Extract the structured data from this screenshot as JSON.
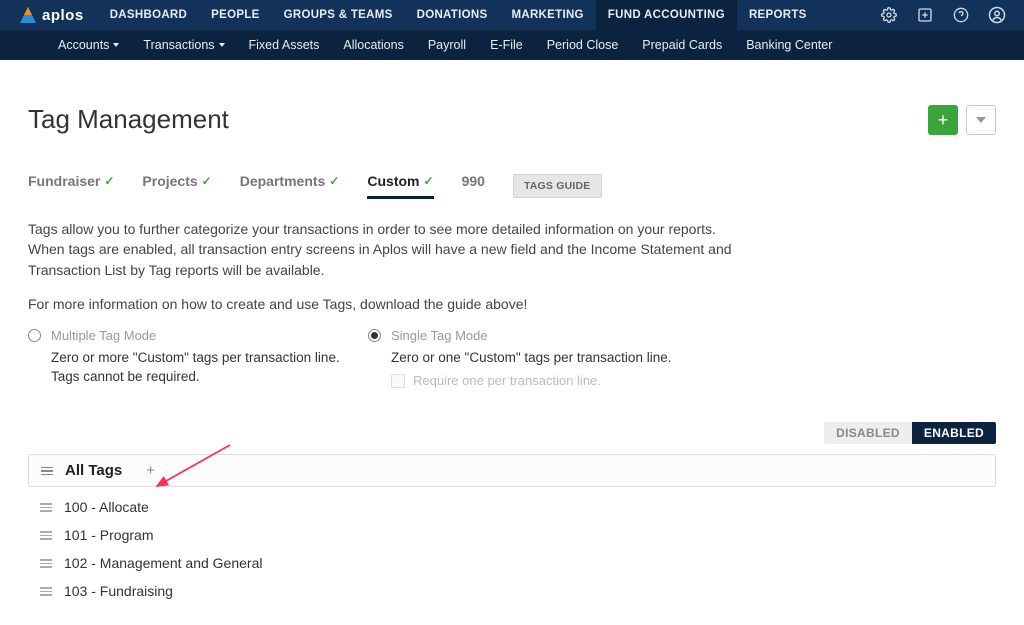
{
  "logo_text": "aplos",
  "nav": {
    "items": [
      {
        "label": "DASHBOARD"
      },
      {
        "label": "PEOPLE"
      },
      {
        "label": "GROUPS & TEAMS"
      },
      {
        "label": "DONATIONS"
      },
      {
        "label": "MARKETING"
      },
      {
        "label": "FUND ACCOUNTING",
        "active": true
      },
      {
        "label": "REPORTS"
      }
    ]
  },
  "subnav": {
    "items": [
      {
        "label": "Accounts",
        "dropdown": true
      },
      {
        "label": "Transactions",
        "dropdown": true
      },
      {
        "label": "Fixed Assets"
      },
      {
        "label": "Allocations"
      },
      {
        "label": "Payroll"
      },
      {
        "label": "E-File"
      },
      {
        "label": "Period Close"
      },
      {
        "label": "Prepaid Cards"
      },
      {
        "label": "Banking Center"
      }
    ]
  },
  "page_title": "Tag Management",
  "tabs": [
    {
      "label": "Fundraiser",
      "check": true
    },
    {
      "label": "Projects",
      "check": true
    },
    {
      "label": "Departments",
      "check": true
    },
    {
      "label": "Custom",
      "check": true,
      "active": true
    },
    {
      "label": "990"
    }
  ],
  "tags_guide_label": "TAGS GUIDE",
  "description": {
    "p1": "Tags allow you to further categorize your transactions in order to see more detailed information on your reports. When tags are enabled, all transaction entry screens in Aplos will have a new field and the Income Statement and Transaction List by Tag reports will be available.",
    "p2": "For more information on how to create and use Tags, download the guide above!"
  },
  "modes": {
    "multiple": {
      "label": "Multiple Tag Mode",
      "sub": "Zero or more \"Custom\" tags per transaction line. Tags cannot be required."
    },
    "single": {
      "label": "Single Tag Mode",
      "sub": "Zero or one \"Custom\" tags per transaction line.",
      "require_label": "Require one per transaction line."
    },
    "selected": "single"
  },
  "status": {
    "disabled_label": "DISABLED",
    "enabled_label": "ENABLED",
    "value": "enabled"
  },
  "panel": {
    "title": "All Tags",
    "items": [
      {
        "label": "100 - Allocate"
      },
      {
        "label": "101 - Program"
      },
      {
        "label": "102 - Management and General"
      },
      {
        "label": "103 - Fundraising"
      }
    ]
  }
}
